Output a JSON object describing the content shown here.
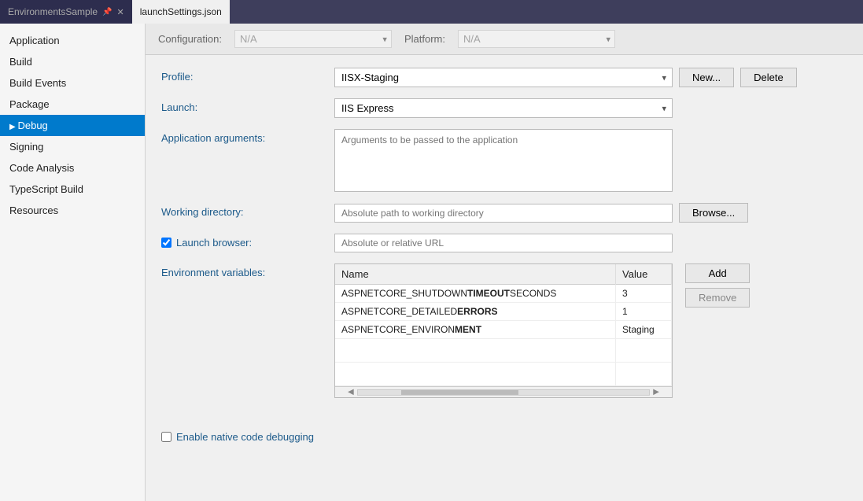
{
  "titlebar": {
    "tabs": [
      {
        "id": "environments-sample",
        "label": "EnvironmentsSample",
        "active": false,
        "has_close": true,
        "has_pin": true
      },
      {
        "id": "launch-settings",
        "label": "launchSettings.json",
        "active": true,
        "has_close": false,
        "has_pin": false
      }
    ]
  },
  "sidebar": {
    "items": [
      {
        "id": "application",
        "label": "Application",
        "active": false
      },
      {
        "id": "build",
        "label": "Build",
        "active": false
      },
      {
        "id": "build-events",
        "label": "Build Events",
        "active": false
      },
      {
        "id": "package",
        "label": "Package",
        "active": false
      },
      {
        "id": "debug",
        "label": "Debug",
        "active": true
      },
      {
        "id": "signing",
        "label": "Signing",
        "active": false
      },
      {
        "id": "code-analysis",
        "label": "Code Analysis",
        "active": false
      },
      {
        "id": "typescript-build",
        "label": "TypeScript Build",
        "active": false
      },
      {
        "id": "resources",
        "label": "Resources",
        "active": false
      }
    ]
  },
  "config_bar": {
    "configuration_label": "Configuration:",
    "configuration_value": "N/A",
    "platform_label": "Platform:",
    "platform_value": "N/A"
  },
  "form": {
    "profile_label": "Profile:",
    "profile_value": "IISX-Staging",
    "new_button": "New...",
    "delete_button": "Delete",
    "launch_label": "Launch:",
    "launch_value": "IIS Express",
    "app_args_label": "Application arguments:",
    "app_args_placeholder": "Arguments to be passed to the application",
    "working_dir_label": "Working directory:",
    "working_dir_placeholder": "Absolute path to working directory",
    "browse_button": "Browse...",
    "launch_browser_label": "Launch browser:",
    "launch_browser_checked": true,
    "launch_browser_placeholder": "Absolute or relative URL",
    "env_vars_label": "Environment variables:",
    "env_table": {
      "columns": [
        "Name",
        "Value"
      ],
      "rows": [
        {
          "name": "ASPNETCORE_SHUTDOWNTIMEOUTSECONDS",
          "value": "3",
          "selected": false
        },
        {
          "name": "ASPNETCORE_DETAILEDERRORS",
          "value": "1",
          "selected": false
        },
        {
          "name": "ASPNETCORE_ENVIRONMENT",
          "value": "Staging",
          "selected": false
        }
      ]
    },
    "add_button": "Add",
    "remove_button": "Remove",
    "native_debug_label": "Enable native code debugging",
    "native_debug_checked": false
  }
}
